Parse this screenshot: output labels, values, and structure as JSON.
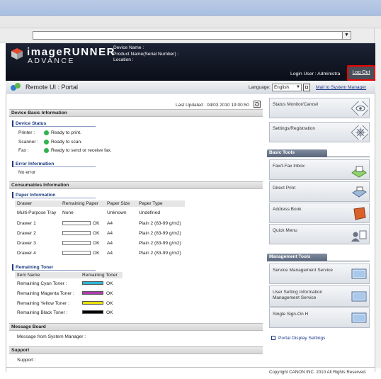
{
  "browser": {
    "address_dropdown_glyph": "▼"
  },
  "header": {
    "brand_main": "imageRUNNER",
    "brand_sub": "ADVANCE",
    "device_name_label": "Device Name :",
    "product_name_label": "Product Name(Serial Number) :",
    "location_label": "Location :",
    "login_user": "Login User : Administra",
    "logout": "Log Out"
  },
  "portalbar": {
    "title": "Remote UI : Portal",
    "language_label": "Language:",
    "language_value": "English",
    "mail_link": "Mail to System Manager"
  },
  "main": {
    "last_updated": "Last Updated : 04/03 2010 19:00:50",
    "device_basic": {
      "title": "Device Basic Information",
      "status_title": "Device Status",
      "statuses": [
        {
          "label": "Printer :",
          "text": "Ready to print."
        },
        {
          "label": "Scanner :",
          "text": "Ready to scan."
        },
        {
          "label": "Fax :",
          "text": "Ready to send or receive fax."
        }
      ],
      "error_title": "Error Information",
      "error_text": "No error"
    },
    "consumables": {
      "title": "Consumables Information",
      "paper_title": "Paper Information",
      "columns": [
        "Drawer",
        "Remaining Paper",
        "Paper Size",
        "Paper Type"
      ],
      "rows": [
        {
          "drawer": "Multi-Purpose Tray",
          "remaining": "None",
          "size": "Unknown",
          "type": "Undefined",
          "bar": false
        },
        {
          "drawer": "Drawer 1",
          "remaining": "OK",
          "size": "A4",
          "type": "Plain 2 (83-99 g/m2)",
          "bar": true
        },
        {
          "drawer": "Drawer 2",
          "remaining": "OK",
          "size": "A4",
          "type": "Plain 2 (83-99 g/m2)",
          "bar": true
        },
        {
          "drawer": "Drawer 3",
          "remaining": "OK",
          "size": "A4",
          "type": "Plain 2 (83-99 g/m2)",
          "bar": true
        },
        {
          "drawer": "Drawer 4",
          "remaining": "OK",
          "size": "A4",
          "type": "Plain 2 (83-99 g/m2)",
          "bar": true
        }
      ],
      "toner_title": "Remaining Toner",
      "toner_columns": [
        "Item Name",
        "Remaining Toner"
      ],
      "toners": [
        {
          "name": "Remaining Cyan Toner :",
          "status": "OK",
          "color": "#29b6d6"
        },
        {
          "name": "Remaining Magenta Toner :",
          "status": "OK",
          "color": "#b03bb0"
        },
        {
          "name": "Remaining Yellow Toner :",
          "status": "OK",
          "color": "#e8e000"
        },
        {
          "name": "Remaining Black Toner :",
          "status": "OK",
          "color": "#000000"
        }
      ]
    },
    "message_board": {
      "title": "Message Board",
      "text": "Message from System Manager :"
    },
    "support": {
      "title": "Support",
      "text": "Support :"
    }
  },
  "right": {
    "status_monitor": "Status Monitor/Cancel",
    "settings": "Settings/Registration",
    "basic_tools_title": "Basic Tools",
    "basic_tools": [
      "Fax/I-Fax Inbox",
      "Direct Print",
      "Address Book",
      "Quick Menu"
    ],
    "management_title": "Management Tools",
    "management_tools": [
      "Service Management Service",
      "User Setting Information Management Service",
      "Single Sign-On H"
    ],
    "portal_display": "Portal Display Settings"
  },
  "footer": {
    "copyright": "Copyright CANON INC. 2010 All Rights Reserved."
  },
  "colors": {
    "status_ok": "#2fb34f",
    "highlight_red": "#e00000",
    "link_blue": "#1c3b8a"
  }
}
